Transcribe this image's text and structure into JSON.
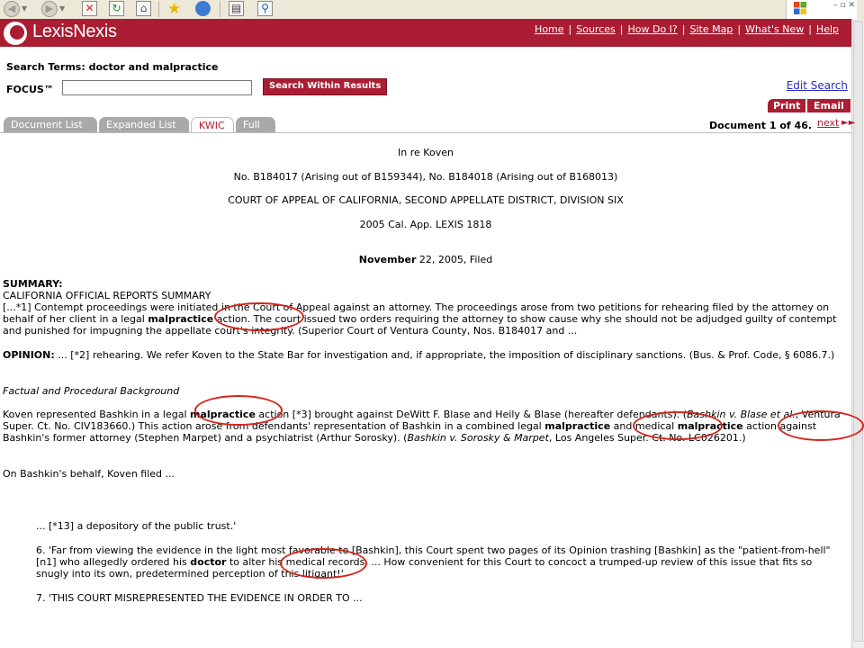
{
  "brand": {
    "name": "LexisNexis",
    "accent": "#aa1d32",
    "circle": "#d2261b"
  },
  "topnav": [
    "Home",
    "Sources",
    "How Do I?",
    "Site Map",
    "What's New",
    "Help"
  ],
  "search": {
    "terms_label": "Search Terms: doctor and malpractice",
    "focus_label": "FOCUS™",
    "focus_value": "",
    "within_button": "Search Within Results",
    "edit_link": "Edit Search"
  },
  "actions": {
    "print": "Print",
    "email": "Email"
  },
  "tabs": [
    {
      "label": "Document List",
      "active": false
    },
    {
      "label": "Expanded List",
      "active": false
    },
    {
      "label": "KWIC",
      "active": true
    },
    {
      "label": "Full",
      "active": false
    }
  ],
  "pager": {
    "document": "Document 1 of 46.",
    "next": "next",
    "next_arrows": "►►"
  },
  "doc": {
    "title": "In re Koven",
    "docket": "No. B184017 (Arising out of B159344), No. B184018 (Arising out of B168013)",
    "court": "COURT OF APPEAL OF CALIFORNIA, SECOND APPELLATE DISTRICT, DIVISION SIX",
    "cite": "2005 Cal. App. LEXIS 1818",
    "date_hit": "November",
    "date_rest": " 22, 2005, Filed",
    "summary_heading": "SUMMARY:",
    "summary_sub": "CALIFORNIA OFFICIAL REPORTS SUMMARY",
    "summary_p1": " [...*1] Contempt proceedings were initiated in the Court of Appeal against an attorney. The proceedings arose from two petitions for rehearing filed by the attorney on behalf of her client in a legal ",
    "summary_hit": "malpractice",
    "summary_p2": " action. The court issued two orders requiring the attorney to show cause why she should not be adjudged guilty of contempt and punished for impugning the appellate court's integrity. (Superior Court of Ventura County, Nos. B184017 and ...",
    "opinion_heading": "OPINION:",
    "opinion_text": " ... [*2] rehearing. We refer Koven to the State Bar for investigation and, if appropriate, the imposition of disciplinary sanctions. (Bus. & Prof. Code, § 6086.7.)",
    "factual_heading": "Factual and Procedural Background",
    "f1": "Koven represented Bashkin in a legal ",
    "f_hit1": "malpractice",
    "f2": " action [*3]  brought against DeWitt F. Blase and Heily & Blase (hereafter defendants). (",
    "f_ital1": "Bashkin v. Blase et al.",
    "f3": ", Ventura Super. Ct. No. CIV183660.) This action arose from defendants' representation of Bashkin in a combined legal ",
    "f_hit2": "malpractice",
    "f4": " and medical ",
    "f_hit3": "malpractice",
    "f5": " action against Bashkin's former attorney (Stephen Marpet) and a psychiatrist (Arthur Sorosky). (",
    "f_ital2": "Bashkin v. Sorosky & Marpet",
    "f6": ", Los Angeles Super. Ct. No. LC026201.)",
    "onbehalf": "On Bashkin's behalf, Koven filed ...",
    "q13": "... [*13] a depository of the public trust.'",
    "q6a": "6. 'Far from viewing the evidence in the light most favorable to [Bashkin], this Court spent two pages of its Opinion trashing [Bashkin] as the \"patient-from-hell\"[n1] who allegedly ordered his ",
    "q6_hit": "doctor",
    "q6b": " to alter his medical records. ... How convenient for this Court to concoct a trumped-up review of this issue that fits so snugly into its own, predetermined perception of this litigant!'",
    "q7": "7. 'THIS COURT MISREPRESENTED THE EVIDENCE IN ORDER TO ..."
  }
}
